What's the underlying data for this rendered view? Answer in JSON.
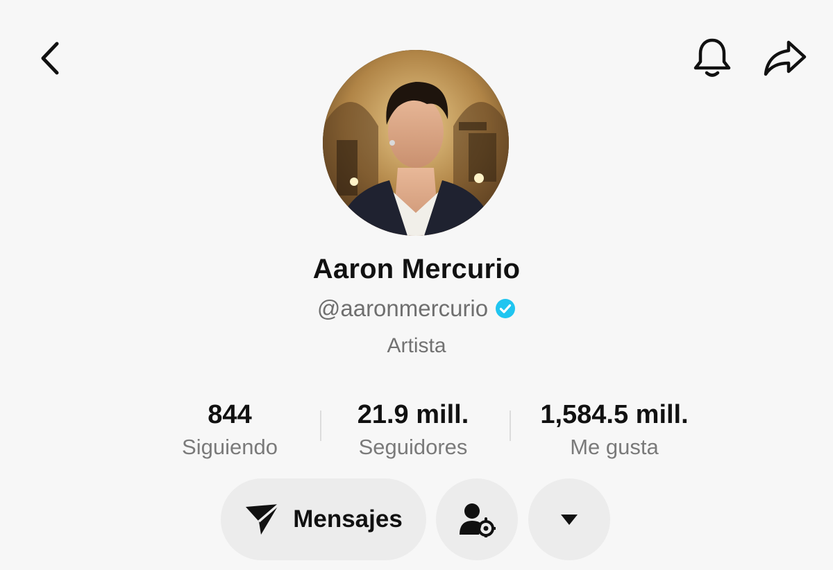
{
  "header": {
    "back_icon": "chevron-left-icon",
    "bell_icon": "bell-icon",
    "share_icon": "share-arrow-icon"
  },
  "profile": {
    "name": "Aaron Mercurio",
    "handle": "@aaronmercurio",
    "verified": true,
    "verified_color": "#20c5f0",
    "category": "Artista"
  },
  "stats": [
    {
      "value": "844",
      "label": "Siguiendo"
    },
    {
      "value": "21.9 mill.",
      "label": "Seguidores"
    },
    {
      "value": "1,584.5 mill.",
      "label": "Me gusta"
    }
  ],
  "actions": {
    "message_label": "Mensajes",
    "message_icon": "send-icon",
    "friend_icon": "user-settings-icon",
    "more_icon": "caret-down-icon"
  }
}
